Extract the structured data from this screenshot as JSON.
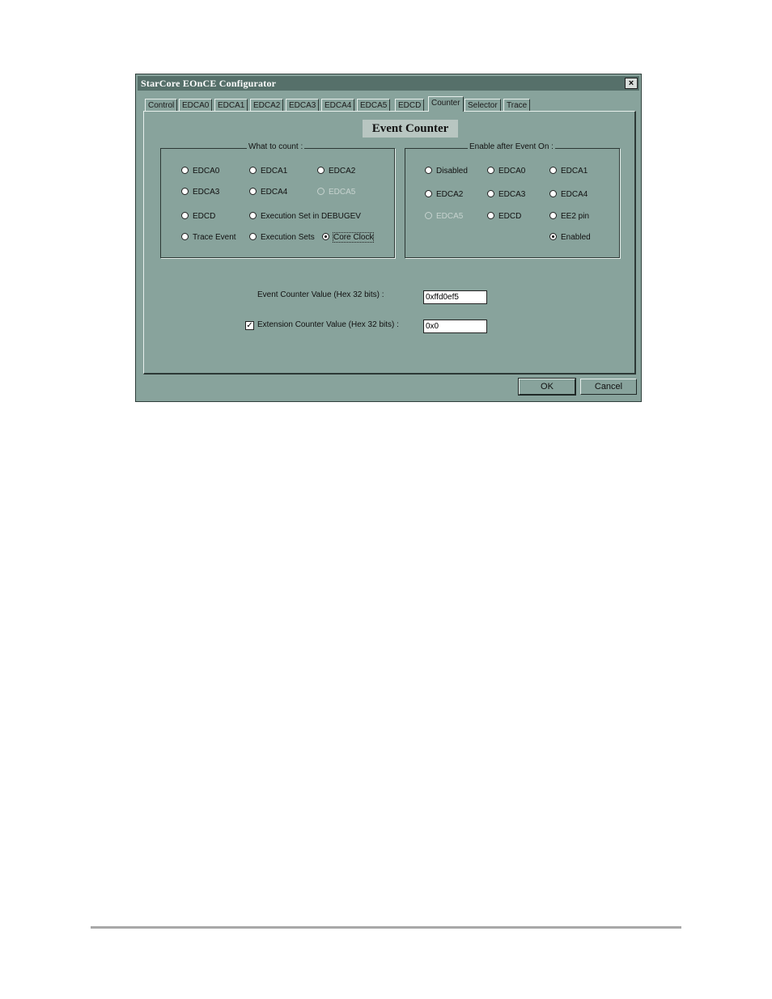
{
  "window": {
    "title": "StarCore EOnCE Configurator",
    "close_glyph": "×"
  },
  "tabs": [
    {
      "label": "Control"
    },
    {
      "label": "EDCA0"
    },
    {
      "label": "EDCA1"
    },
    {
      "label": "EDCA2"
    },
    {
      "label": "EDCA3"
    },
    {
      "label": "EDCA4"
    },
    {
      "label": "EDCA5"
    },
    {
      "label": "EDCD"
    },
    {
      "label": "Counter"
    },
    {
      "label": "Selector"
    },
    {
      "label": "Trace"
    }
  ],
  "active_tab": "Counter",
  "section_title": "Event Counter",
  "what_to_count": {
    "legend": "What to count :",
    "options": [
      {
        "label": "EDCA0"
      },
      {
        "label": "EDCA1"
      },
      {
        "label": "EDCA2"
      },
      {
        "label": "EDCA3"
      },
      {
        "label": "EDCA4"
      },
      {
        "label": "EDCA5"
      },
      {
        "label": "EDCD"
      },
      {
        "label": "Execution Set in DEBUGEV"
      },
      {
        "label": "Trace Event"
      },
      {
        "label": "Execution Sets"
      },
      {
        "label": "Core Clock"
      }
    ],
    "selected": "Core Clock",
    "disabled": [
      "EDCA5"
    ]
  },
  "enable_after": {
    "legend": "Enable after Event On :",
    "options": [
      {
        "label": "Disabled"
      },
      {
        "label": "EDCA0"
      },
      {
        "label": "EDCA1"
      },
      {
        "label": "EDCA2"
      },
      {
        "label": "EDCA3"
      },
      {
        "label": "EDCA4"
      },
      {
        "label": "EDCA5"
      },
      {
        "label": "EDCD"
      },
      {
        "label": "EE2 pin"
      },
      {
        "label": "Enabled"
      }
    ],
    "selected": "Enabled",
    "disabled": [
      "EDCA5"
    ]
  },
  "event_counter": {
    "label": "Event Counter Value (Hex 32 bits) :",
    "value": "0xffd0ef5"
  },
  "extension_counter": {
    "label": "Extension Counter Value (Hex 32 bits) :",
    "value": "0x0",
    "checked": true,
    "check_glyph": "✓"
  },
  "buttons": {
    "ok": "OK",
    "cancel": "Cancel"
  }
}
